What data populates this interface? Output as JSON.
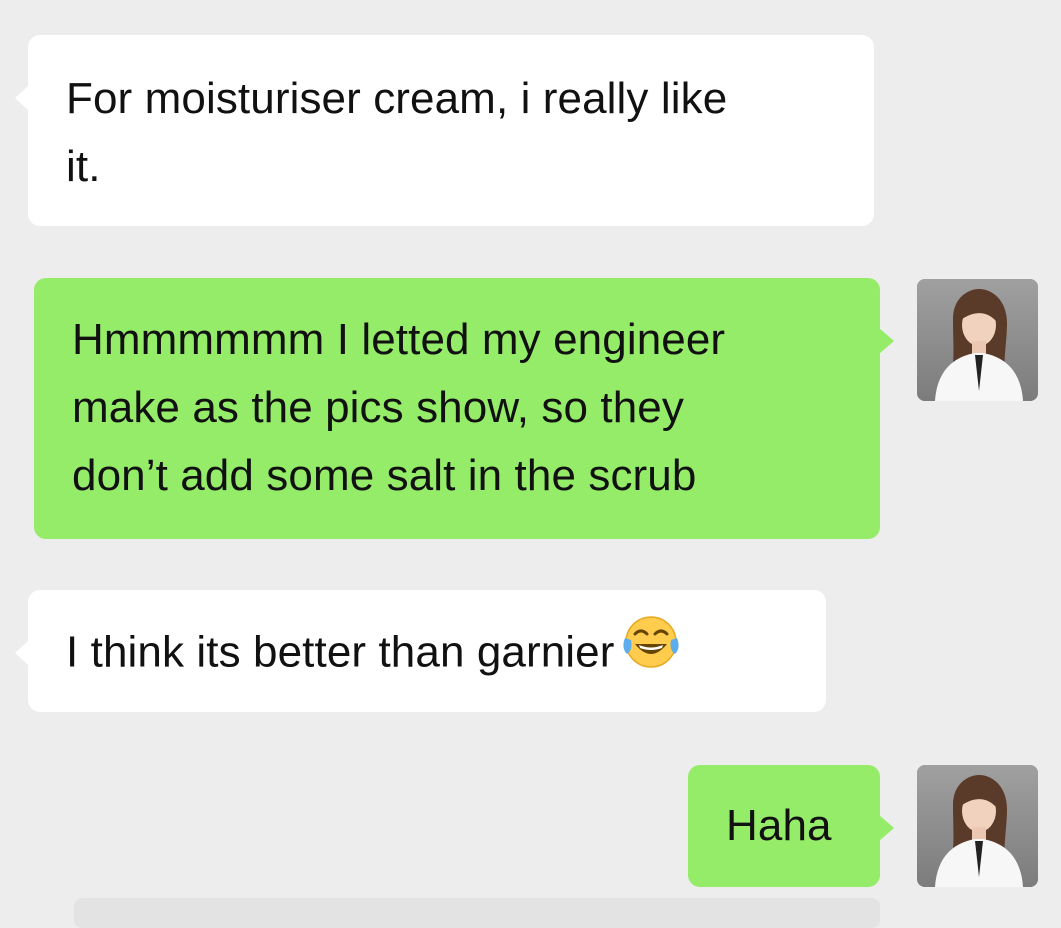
{
  "chat": {
    "messages": [
      {
        "direction": "incoming",
        "text": "For moisturiser cream, i really like\nit."
      },
      {
        "direction": "outgoing",
        "text": "Hmmmmmm I letted my engineer\nmake as the pics show, so they\ndon’t add some salt in the scrub"
      },
      {
        "direction": "incoming",
        "text": "I think its better than garnier",
        "emoji": "face-with-tears-of-joy-icon"
      },
      {
        "direction": "outgoing",
        "text": "Haha"
      }
    ]
  },
  "colors": {
    "background": "#ededed",
    "incoming_bubble": "#ffffff",
    "outgoing_bubble": "#95ec69"
  }
}
